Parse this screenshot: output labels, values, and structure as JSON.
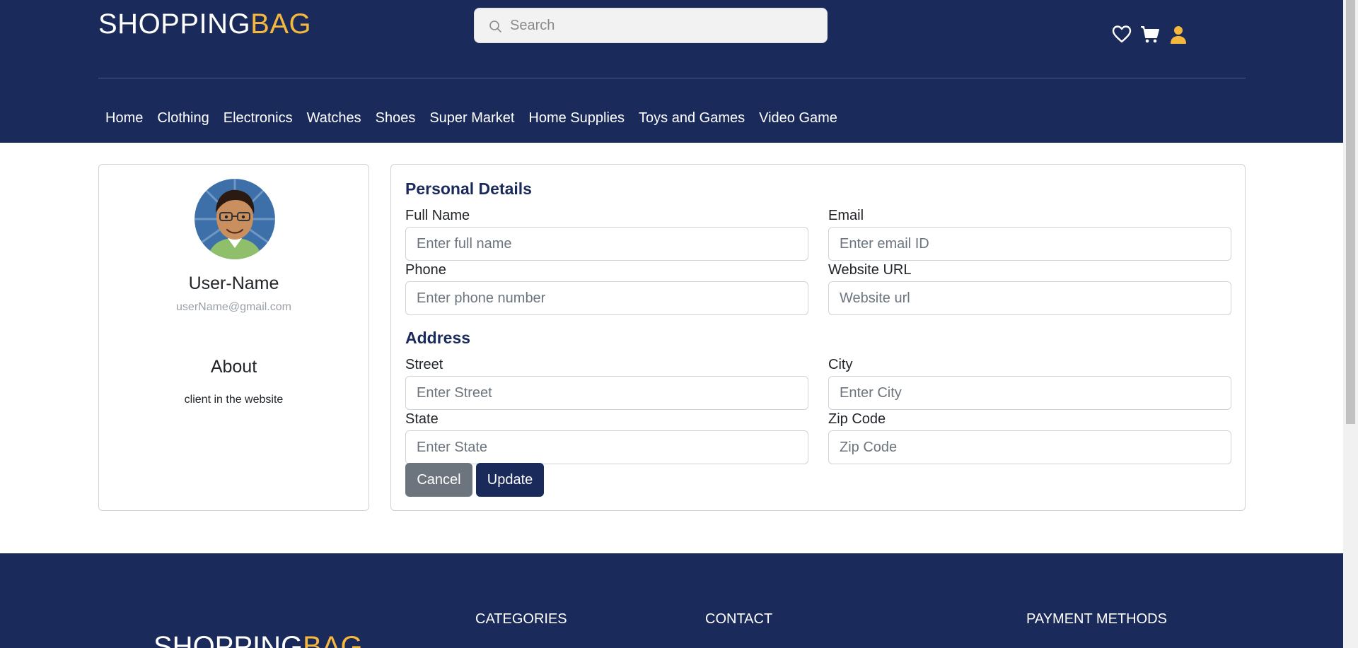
{
  "header": {
    "logo_main": "SHOPPING",
    "logo_accent": "BAG",
    "search_placeholder": "Search",
    "icons": [
      "heart-icon",
      "cart-icon",
      "user-icon"
    ],
    "colors": {
      "background": "#1a2a5a",
      "accent": "#f5b83d"
    }
  },
  "nav": {
    "items": [
      "Home",
      "Clothing",
      "Electronics",
      "Watches",
      "Shoes",
      "Super Market",
      "Home Supplies",
      "Toys and Games",
      "Video Game"
    ]
  },
  "profile": {
    "name": "User-Name",
    "email": "userName@gmail.com",
    "about_title": "About",
    "about_text": "client in the website"
  },
  "form": {
    "personal_title": "Personal Details",
    "full_name": {
      "label": "Full Name",
      "placeholder": "Enter full name",
      "value": ""
    },
    "email": {
      "label": "Email",
      "placeholder": "Enter email ID",
      "value": ""
    },
    "phone": {
      "label": "Phone",
      "placeholder": "Enter phone number",
      "value": ""
    },
    "website": {
      "label": "Website URL",
      "placeholder": "Website url",
      "value": ""
    },
    "address_title": "Address",
    "street": {
      "label": "Street",
      "placeholder": "Enter Street",
      "value": ""
    },
    "city": {
      "label": "City",
      "placeholder": "Enter City",
      "value": ""
    },
    "state": {
      "label": "State",
      "placeholder": "Enter State",
      "value": ""
    },
    "zip": {
      "label": "Zip Code",
      "placeholder": "Zip Code",
      "value": ""
    },
    "cancel_label": "Cancel",
    "update_label": "Update"
  },
  "footer": {
    "logo_main": "SHOPPING",
    "logo_accent": "BAG",
    "categories_heading": "CATEGORIES",
    "contact_heading": "CONTACT",
    "payment_heading": "PAYMENT METHODS"
  }
}
